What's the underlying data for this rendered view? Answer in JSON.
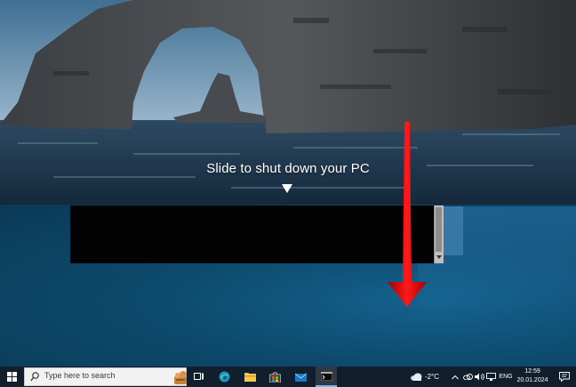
{
  "lock": {
    "slide_message": "Slide to shut down your PC"
  },
  "taskbar": {
    "search_placeholder": "Type here to search",
    "icons": [
      "windows-start-icon",
      "search-icon",
      "task-view-icon",
      "edge-icon",
      "file-explorer-icon",
      "store-icon",
      "mail-icon",
      "terminal-icon"
    ],
    "weather": {
      "temperature": "-2°C"
    },
    "language": "ENG",
    "clock": {
      "time": "12:59",
      "date": "20.01.2024"
    }
  },
  "colors": {
    "taskbar_bg": "#101f2b",
    "arrow_red": "#e8000b",
    "desktop_blue": "#0d4a6d"
  }
}
